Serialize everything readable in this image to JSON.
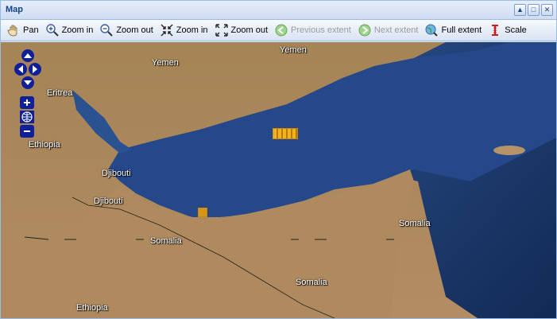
{
  "window": {
    "title": "Map"
  },
  "window_tools": [
    "minimize",
    "maximize",
    "close"
  ],
  "toolbar": {
    "items": [
      {
        "label": "Pan",
        "icon": "hand-icon",
        "enabled": true
      },
      {
        "label": "Zoom in",
        "icon": "magnifier-plus-icon",
        "enabled": true
      },
      {
        "label": "Zoom out",
        "icon": "magnifier-minus-icon",
        "enabled": true
      },
      {
        "label": "Zoom in",
        "icon": "box-zoom-in-icon",
        "enabled": true
      },
      {
        "label": "Zoom out",
        "icon": "box-zoom-out-icon",
        "enabled": true
      },
      {
        "label": "Previous extent",
        "icon": "back-arrow-icon",
        "enabled": false
      },
      {
        "label": "Next extent",
        "icon": "forward-arrow-icon",
        "enabled": false
      },
      {
        "label": "Full extent",
        "icon": "globe-zoom-icon",
        "enabled": true
      },
      {
        "label": "Scale",
        "icon": "scale-icon",
        "enabled": true
      }
    ]
  },
  "map": {
    "labels": [
      {
        "name": "Yemen"
      },
      {
        "name": "Yemen"
      },
      {
        "name": "Eritrea"
      },
      {
        "name": "Ethiopia"
      },
      {
        "name": "Djibouti"
      },
      {
        "name": "Djibouti"
      },
      {
        "name": "Somalia"
      },
      {
        "name": "Somalia"
      },
      {
        "name": "Somalia"
      },
      {
        "name": "Ethiopia"
      }
    ],
    "controls": {
      "pan": [
        "pan-up-icon",
        "pan-left-icon",
        "pan-right-icon",
        "pan-down-icon"
      ],
      "zoom": [
        "zoom-in-icon",
        "zoom-world-icon",
        "zoom-out-icon"
      ]
    },
    "colors": {
      "sea": "#1e3d73",
      "land": "#9c7e57",
      "highlight": "#f1b21e"
    }
  }
}
